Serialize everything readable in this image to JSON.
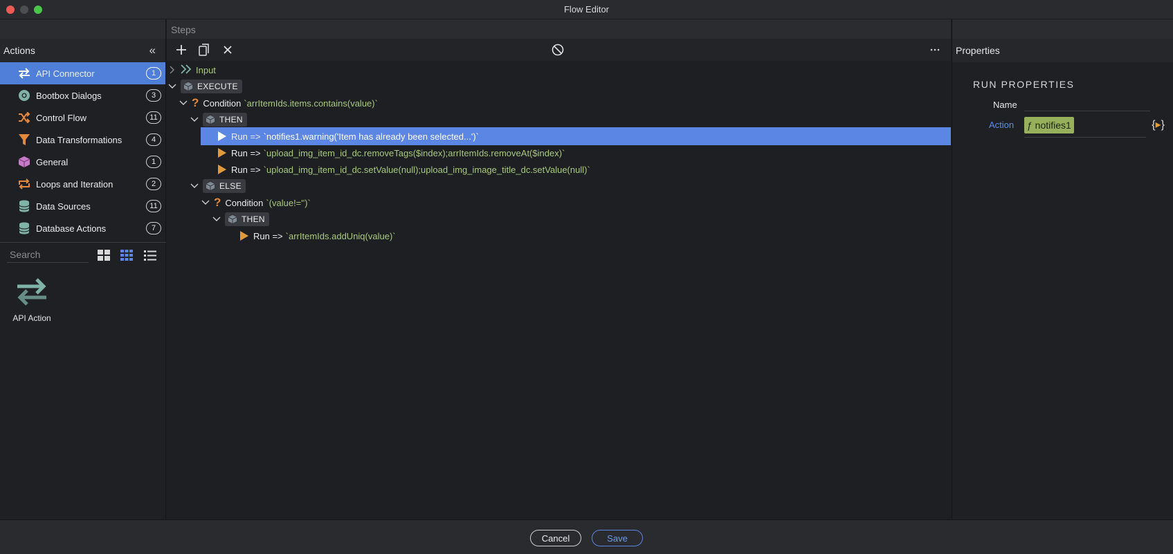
{
  "window": {
    "title": "Flow Editor"
  },
  "actions_panel": {
    "title": "Actions",
    "categories": [
      {
        "label": "API Connector",
        "count": "1",
        "icon": "arrows-swap-icon",
        "color": "#ffffff"
      },
      {
        "label": "Bootbox Dialogs",
        "count": "3",
        "icon": "chrome-icon",
        "color": "#7fb3a8"
      },
      {
        "label": "Control Flow",
        "count": "11",
        "icon": "shuffle-icon",
        "color": "#e6893c"
      },
      {
        "label": "Data Transformations",
        "count": "4",
        "icon": "funnel-icon",
        "color": "#e6893c"
      },
      {
        "label": "General",
        "count": "1",
        "icon": "cube-icon",
        "color": "#c77ac7"
      },
      {
        "label": "Loops and Iteration",
        "count": "2",
        "icon": "loop-icon",
        "color": "#e6893c"
      },
      {
        "label": "Data Sources",
        "count": "11",
        "icon": "database-icon",
        "color": "#7fb3a8"
      },
      {
        "label": "Database Actions",
        "count": "7",
        "icon": "database-icon",
        "color": "#7fb3a8"
      }
    ],
    "search_placeholder": "Search",
    "tiles": [
      {
        "label": "API Action",
        "icon": "arrows-swap-icon"
      }
    ]
  },
  "steps_panel": {
    "title": "Steps",
    "rows": [
      {
        "type": "input",
        "label": "Input"
      },
      {
        "type": "tag",
        "label": "EXECUTE"
      },
      {
        "type": "condition",
        "keyword": "Condition",
        "code": "`arrItemIds.items.contains(value)`"
      },
      {
        "type": "tag",
        "label": "THEN"
      },
      {
        "type": "run",
        "keyword": "Run =>",
        "code": "`notifies1.warning('Item has already been selected...')`",
        "selected": true
      },
      {
        "type": "run",
        "keyword": "Run =>",
        "code": "`upload_img_item_id_dc.removeTags($index);arrItemIds.removeAt($index)`"
      },
      {
        "type": "run",
        "keyword": "Run =>",
        "code": "`upload_img_item_id_dc.setValue(null);upload_img_image_title_dc.setValue(null)`"
      },
      {
        "type": "tag",
        "label": "ELSE"
      },
      {
        "type": "condition",
        "keyword": "Condition",
        "code": "`(value!='')`"
      },
      {
        "type": "tag",
        "label": "THEN"
      },
      {
        "type": "run",
        "keyword": "Run =>",
        "code": "`arrItemIds.addUniq(value)`"
      }
    ]
  },
  "properties_panel": {
    "title": "Properties",
    "section": "RUN PROPERTIES",
    "name_label": "Name",
    "action_label": "Action",
    "action_value": "ƒ notifies1"
  },
  "footer": {
    "cancel": "Cancel",
    "save": "Save"
  },
  "colors": {
    "accent": "#5b86e4",
    "code": "#a8c97f",
    "run_icon": "#e09a3c"
  }
}
